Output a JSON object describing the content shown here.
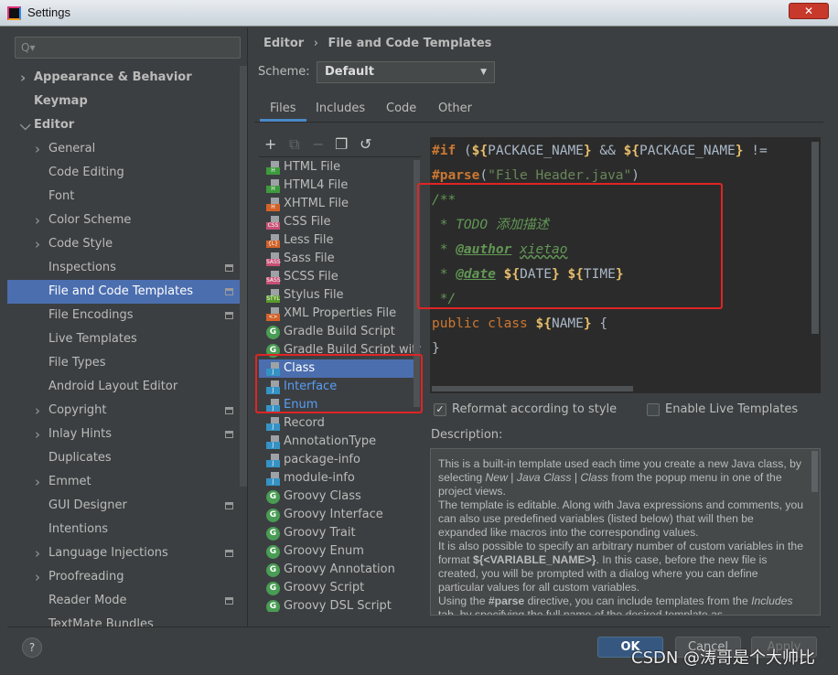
{
  "window": {
    "title": "Settings",
    "close_label": "✕"
  },
  "sidebar": {
    "search_placeholder": "Q▾",
    "items": [
      {
        "label": "Appearance & Behavior",
        "level": 0,
        "expandable": true,
        "expanded": false
      },
      {
        "label": "Keymap",
        "level": 0
      },
      {
        "label": "Editor",
        "level": 0,
        "expandable": true,
        "expanded": true
      },
      {
        "label": "General",
        "level": 1,
        "expandable": true
      },
      {
        "label": "Code Editing",
        "level": 1
      },
      {
        "label": "Font",
        "level": 1
      },
      {
        "label": "Color Scheme",
        "level": 1,
        "expandable": true
      },
      {
        "label": "Code Style",
        "level": 1,
        "expandable": true
      },
      {
        "label": "Inspections",
        "level": 1,
        "project_icon": true
      },
      {
        "label": "File and Code Templates",
        "level": 1,
        "selected": true,
        "project_icon": true
      },
      {
        "label": "File Encodings",
        "level": 1,
        "project_icon": true
      },
      {
        "label": "Live Templates",
        "level": 1
      },
      {
        "label": "File Types",
        "level": 1
      },
      {
        "label": "Android Layout Editor",
        "level": 1
      },
      {
        "label": "Copyright",
        "level": 1,
        "expandable": true,
        "project_icon": true
      },
      {
        "label": "Inlay Hints",
        "level": 1,
        "expandable": true,
        "project_icon": true
      },
      {
        "label": "Duplicates",
        "level": 1
      },
      {
        "label": "Emmet",
        "level": 1,
        "expandable": true
      },
      {
        "label": "GUI Designer",
        "level": 1,
        "project_icon": true
      },
      {
        "label": "Intentions",
        "level": 1
      },
      {
        "label": "Language Injections",
        "level": 1,
        "expandable": true,
        "project_icon": true
      },
      {
        "label": "Proofreading",
        "level": 1,
        "expandable": true
      },
      {
        "label": "Reader Mode",
        "level": 1,
        "project_icon": true
      },
      {
        "label": "TextMate Bundles",
        "level": 1
      }
    ]
  },
  "breadcrumb": {
    "parent": "Editor",
    "separator": "›",
    "current": "File and Code Templates"
  },
  "scheme": {
    "label": "Scheme:",
    "value": "Default"
  },
  "tabs": [
    {
      "label": "Files",
      "active": true
    },
    {
      "label": "Includes"
    },
    {
      "label": "Code"
    },
    {
      "label": "Other"
    }
  ],
  "toolbar": {
    "add": "+",
    "copy_template": "⧉",
    "remove": "−",
    "duplicate": "❐",
    "reset": "↺"
  },
  "files": [
    {
      "label": "HTML File",
      "icon": "H",
      "color": "#3d9a3d"
    },
    {
      "label": "HTML4 File",
      "icon": "H",
      "color": "#3d9a3d"
    },
    {
      "label": "XHTML File",
      "icon": "H",
      "color": "#d2622a"
    },
    {
      "label": "CSS File",
      "icon": "CSS",
      "color": "#c75075"
    },
    {
      "label": "Less File",
      "icon": "{L}",
      "color": "#d2622a"
    },
    {
      "label": "Sass File",
      "icon": "SASS",
      "color": "#c75075"
    },
    {
      "label": "SCSS File",
      "icon": "SASS",
      "color": "#c75075"
    },
    {
      "label": "Stylus File",
      "icon": "STYL",
      "color": "#5a9a2a"
    },
    {
      "label": "XML Properties File",
      "icon": "<>",
      "color": "#d2622a"
    },
    {
      "label": "Gradle Build Script",
      "icon": "G",
      "type": "gradle"
    },
    {
      "label": "Gradle Build Script with Kotlin DSL",
      "icon": "G",
      "type": "gradle"
    },
    {
      "label": "Class",
      "icon": "J",
      "color": "#3592c4",
      "selected": true
    },
    {
      "label": "Interface",
      "icon": "J",
      "color": "#3592c4",
      "modified": true
    },
    {
      "label": "Enum",
      "icon": "J",
      "color": "#3592c4",
      "modified": true
    },
    {
      "label": "Record",
      "icon": "J",
      "color": "#3592c4"
    },
    {
      "label": "AnnotationType",
      "icon": "J",
      "color": "#3592c4"
    },
    {
      "label": "package-info",
      "icon": "J",
      "color": "#3592c4"
    },
    {
      "label": "module-info",
      "icon": "J",
      "color": "#3592c4"
    },
    {
      "label": "Groovy Class",
      "icon": "G",
      "type": "gradle"
    },
    {
      "label": "Groovy Interface",
      "icon": "G",
      "type": "gradle"
    },
    {
      "label": "Groovy Trait",
      "icon": "G",
      "type": "gradle"
    },
    {
      "label": "Groovy Enum",
      "icon": "G",
      "type": "gradle"
    },
    {
      "label": "Groovy Annotation",
      "icon": "G",
      "type": "gradle"
    },
    {
      "label": "Groovy Script",
      "icon": "G",
      "type": "gradle"
    },
    {
      "label": "Groovy DSL Script",
      "icon": "G",
      "type": "gradle"
    }
  ],
  "code": {
    "l1": {
      "a": "#if",
      "b": " (",
      "c": "${",
      "d": "PACKAGE_NAME",
      "e": "}",
      "f": " && ",
      "g": "${",
      "h": "PACKAGE_NAME",
      "i": "}",
      "j": " !="
    },
    "l2": {
      "a": "#parse",
      "b": "(",
      "c": "\"File Header.java\"",
      "d": ")"
    },
    "l3": "/**",
    "l4": {
      "a": " * TODO ",
      "b": "添加描述"
    },
    "l5": {
      "a": " * ",
      "b": "@author",
      "c": " ",
      "d": "xietao"
    },
    "l6": {
      "a": " * ",
      "b": "@date",
      "c": " ",
      "d": "${",
      "e": "DATE",
      "f": "}",
      "g": " ",
      "h": "${",
      "i": "TIME",
      "j": "}"
    },
    "l7": " */",
    "l8": {
      "a": "public class ",
      "b": "${",
      "c": "NAME",
      "d": "}",
      "e": " {"
    },
    "l9": "}"
  },
  "options": {
    "reformat": {
      "label": "Reformat according to style",
      "checked": true
    },
    "live_templates": {
      "label": "Enable Live Templates",
      "checked": false
    }
  },
  "description": {
    "label": "Description:",
    "p1a": "This is a built-in template used each time you create a new Java class, by selecting ",
    "p1b": "New",
    "p1c": " | ",
    "p1d": "Java Class",
    "p1e": " | ",
    "p1f": "Class",
    "p1g": " from the popup menu in one of the project views.",
    "p2": "The template is editable. Along with Java expressions and comments, you can also use predefined variables (listed below) that will then be expanded like macros into the corresponding values.",
    "p3a": "It is also possible to specify an arbitrary number of custom variables in the format ",
    "p3b": "${<VARIABLE_NAME>}",
    "p3c": ". In this case, before the new file is created, you will be prompted with a dialog where you can define particular values for all custom variables.",
    "p4a": "Using the ",
    "p4b": "#parse",
    "p4c": " directive, you can include templates from the ",
    "p4d": "Includes",
    "p4e": " tab, by specifying the full name of the desired template as"
  },
  "buttons": {
    "help": "?",
    "ok": "OK",
    "cancel": "Cancel",
    "apply": "Apply"
  },
  "watermark": "CSDN @涛哥是个大帅比",
  "colors": {
    "accent": "#4b6eaf",
    "highlight_box": "#e02424",
    "modified_text": "#589df6"
  }
}
